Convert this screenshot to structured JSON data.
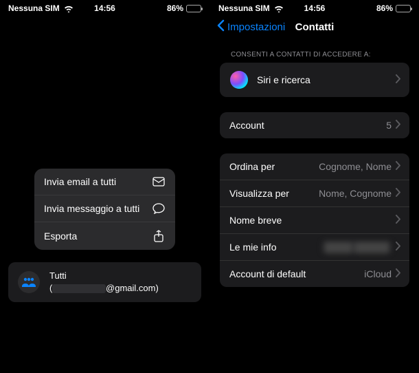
{
  "statusBar": {
    "carrier": "Nessuna SIM",
    "time": "14:56",
    "batteryPercent": "86%",
    "batteryFill": "86%"
  },
  "left": {
    "menu": {
      "email": "Invia email a tutti",
      "message": "Invia messaggio a tutti",
      "export": "Esporta"
    },
    "group": {
      "title": "Tutti",
      "emailMasked": "████████",
      "emailSuffix": "@gmail.com)"
    }
  },
  "right": {
    "back": "Impostazioni",
    "title": "Contatti",
    "sectionAllow": "CONSENTI A CONTATTI DI ACCEDERE A:",
    "siri": "Siri e ricerca",
    "account": {
      "label": "Account",
      "value": "5"
    },
    "sortBy": {
      "label": "Ordina per",
      "value": "Cognome, Nome"
    },
    "displayBy": {
      "label": "Visualizza per",
      "value": "Nome, Cognome"
    },
    "shortName": {
      "label": "Nome breve"
    },
    "myInfo": {
      "label": "Le mie info",
      "valueMasked": "████ █████"
    },
    "defaultAccount": {
      "label": "Account di default",
      "value": "iCloud"
    }
  }
}
